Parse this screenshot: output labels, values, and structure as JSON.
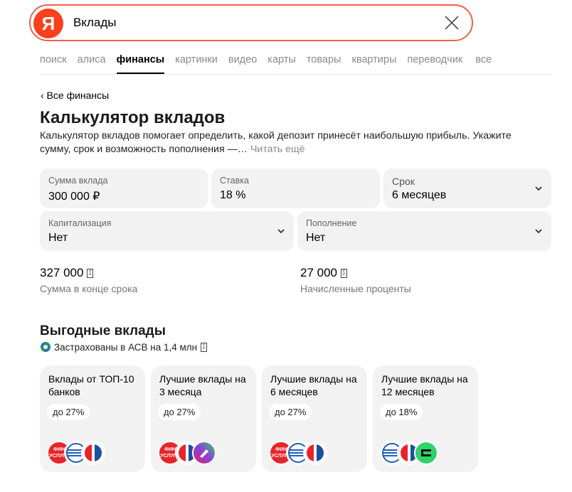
{
  "search": {
    "query": "Вклады",
    "logo_letter": "Я"
  },
  "tabs": [
    "поиск",
    "алиса",
    "финансы",
    "картинки",
    "видео",
    "карты",
    "товары",
    "квартиры",
    "переводчик",
    "все"
  ],
  "breadcrumb": "‹ Все финансы",
  "title": "Калькулятор вкладов",
  "description": "Калькулятор вкладов помогает определить, какой депозит принесёт наибольшую прибыль. Укажите сумму, срок и возможность пополнения —…",
  "read_more": "Читать ещё",
  "fields": {
    "amount": {
      "label": "Сумма вклада",
      "value": "300 000 ₽"
    },
    "rate": {
      "label": "Ставка",
      "value": "18 %"
    },
    "term": {
      "label": "Срок",
      "value": "6 месяцев"
    },
    "capitalization": {
      "label": "Капитализация",
      "value": "Нет"
    },
    "replenishment": {
      "label": "Пополнение",
      "value": "Нет"
    }
  },
  "results": {
    "total": {
      "value": "327 000",
      "label": "Сумма в конце срока"
    },
    "interest": {
      "value": "27 000",
      "label": "Начисленные проценты"
    }
  },
  "offers": {
    "title": "Выгодные вклады",
    "insured": "Застрахованы в АСВ на 1,4 млн",
    "cards": [
      {
        "title": "Вклады от ТОП-10 банков",
        "badge": "до 27%"
      },
      {
        "title": "Лучшие вклады на 3 месяца",
        "badge": "до 27%"
      },
      {
        "title": "Лучшие вклады на 6 месяцев",
        "badge": "до 27%"
      },
      {
        "title": "Лучшие вклады на 12 месяцев",
        "badge": "до 18%"
      }
    ],
    "logo_text": "ФИН УСЛУГИ"
  },
  "colors": {
    "accent": "#fc3f1d",
    "card_bg": "#f2f2f2",
    "muted": "#8a8a8a"
  }
}
